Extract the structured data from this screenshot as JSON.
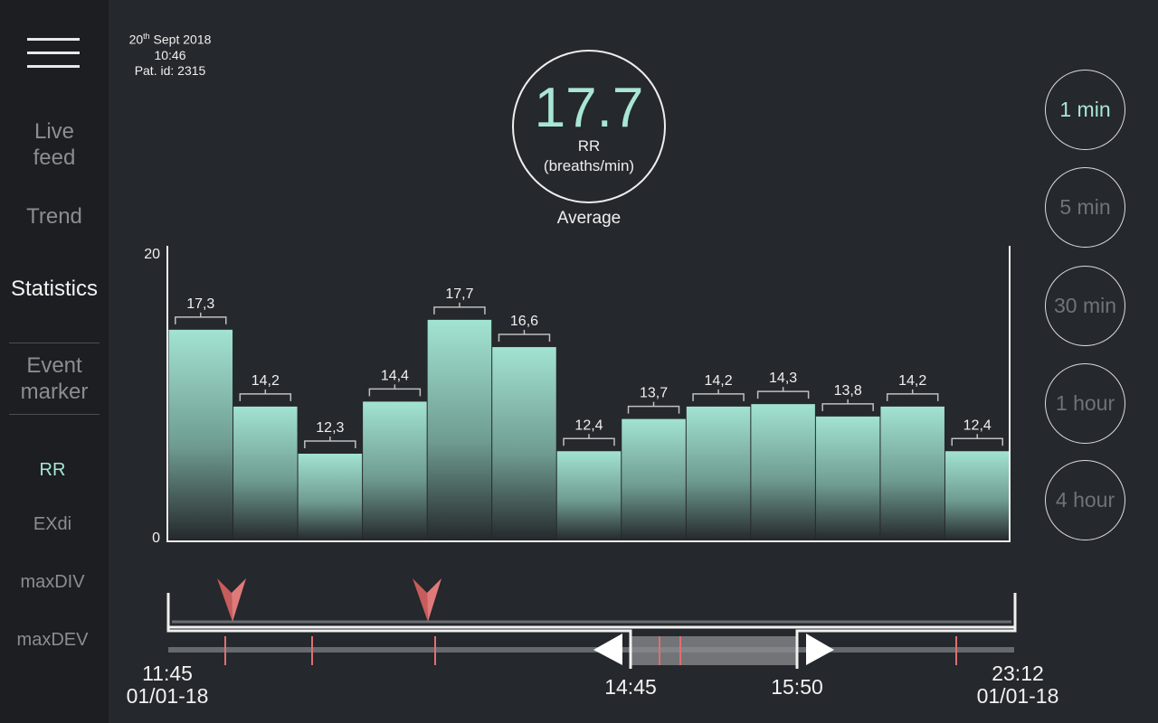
{
  "sidebar": {
    "menu_icon": "hamburger-menu-icon",
    "nav": [
      {
        "label": "Live\nfeed",
        "active": false
      },
      {
        "label": "Trend",
        "active": false
      },
      {
        "label": "Statistics",
        "active": true
      },
      {
        "label": "Event\nmarker",
        "active": false
      }
    ],
    "metrics": [
      {
        "label": "RR",
        "active": true
      },
      {
        "label": "EXdi",
        "active": false
      },
      {
        "label": "maxDIV",
        "active": false
      },
      {
        "label": "maxDEV",
        "active": false
      }
    ]
  },
  "header": {
    "date_day": "20",
    "date_suffix": "th",
    "date_rest": " Sept 2018",
    "time": "10:46",
    "patient": "Pat. id: 2315"
  },
  "average": {
    "value": "17.7",
    "label": "RR\n(breaths/min)",
    "caption": "Average"
  },
  "intervals": [
    {
      "label": "1 min",
      "active": true
    },
    {
      "label": "5 min",
      "active": false
    },
    {
      "label": "30 min",
      "active": false
    },
    {
      "label": "1 hour",
      "active": false
    },
    {
      "label": "4 hour",
      "active": false
    }
  ],
  "chart_data": {
    "type": "bar",
    "labels": [
      "17,3",
      "14,2",
      "12,3",
      "14,4",
      "17,7",
      "16,6",
      "12,4",
      "13,7",
      "14,2",
      "14,3",
      "13,8",
      "14,2",
      "12,4"
    ],
    "values": [
      17.3,
      14.2,
      12.3,
      14.4,
      17.7,
      16.6,
      12.4,
      13.7,
      14.2,
      14.3,
      13.8,
      14.2,
      12.4
    ],
    "yticks": [
      "0",
      "20"
    ],
    "ylim": [
      0,
      20
    ],
    "colors": {
      "bar": "#a2e3d2",
      "axis": "#f0f0f0",
      "bracket": "#bfbfbf"
    }
  },
  "timeline": {
    "start_time": "11:45",
    "start_date": "01/01-18",
    "end_time": "23:12",
    "end_date": "01/01-18",
    "window_start": "14:45",
    "window_end": "15:50",
    "colors": {
      "track": "#666a6f",
      "selection": "#9a9a9a",
      "event": "#e06f6f",
      "marker": "#d96a6a"
    }
  }
}
